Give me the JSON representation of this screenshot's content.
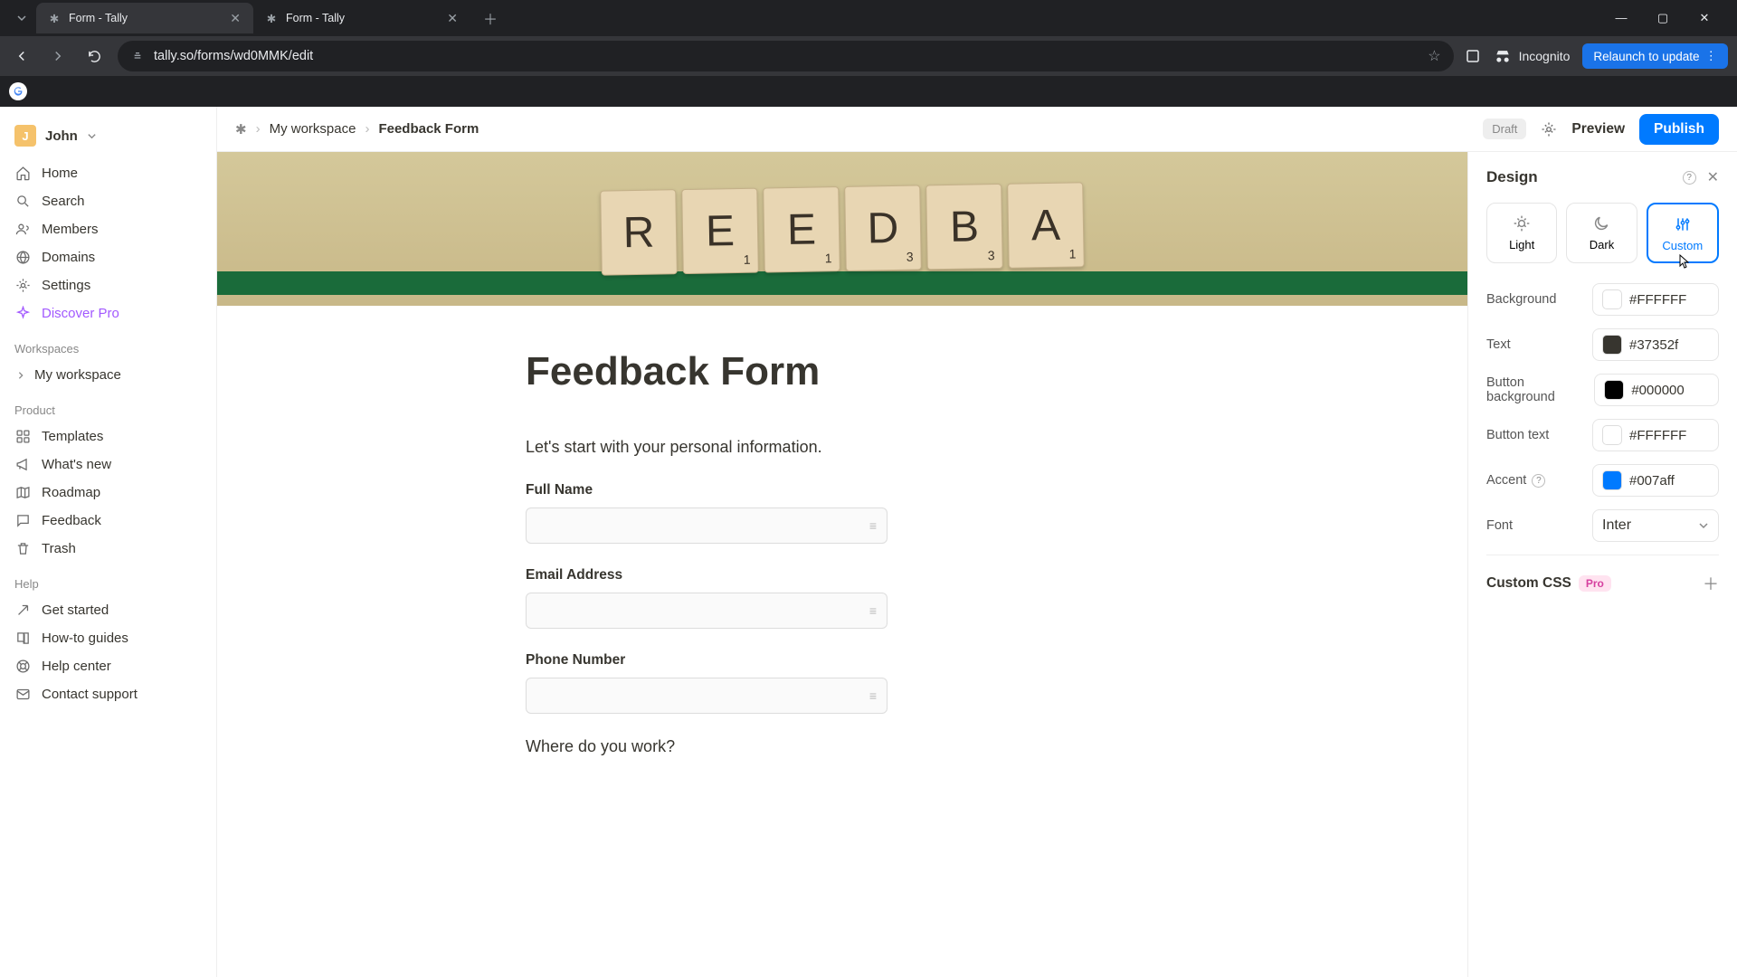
{
  "browser": {
    "tabs": [
      {
        "title": "Form - Tally",
        "active": true
      },
      {
        "title": "Form - Tally",
        "active": false
      }
    ],
    "url": "tally.so/forms/wd0MMK/edit",
    "incognito_label": "Incognito",
    "relaunch_label": "Relaunch to update",
    "bookmark_initial": "G"
  },
  "user": {
    "initial": "J",
    "name": "John"
  },
  "sidebar": {
    "nav": [
      {
        "key": "home",
        "label": "Home",
        "icon": "home"
      },
      {
        "key": "search",
        "label": "Search",
        "icon": "search"
      },
      {
        "key": "members",
        "label": "Members",
        "icon": "members"
      },
      {
        "key": "domains",
        "label": "Domains",
        "icon": "globe"
      },
      {
        "key": "settings",
        "label": "Settings",
        "icon": "gear"
      },
      {
        "key": "discover",
        "label": "Discover Pro",
        "icon": "sparkle",
        "pro": true
      }
    ],
    "workspaces_header": "Workspaces",
    "workspace_name": "My workspace",
    "product_header": "Product",
    "product": [
      {
        "key": "templates",
        "label": "Templates",
        "icon": "templates"
      },
      {
        "key": "whatsnew",
        "label": "What's new",
        "icon": "megaphone"
      },
      {
        "key": "roadmap",
        "label": "Roadmap",
        "icon": "map"
      },
      {
        "key": "feedback",
        "label": "Feedback",
        "icon": "chat"
      },
      {
        "key": "trash",
        "label": "Trash",
        "icon": "trash"
      }
    ],
    "help_header": "Help",
    "help": [
      {
        "key": "getstarted",
        "label": "Get started",
        "icon": "compass"
      },
      {
        "key": "howto",
        "label": "How-to guides",
        "icon": "book"
      },
      {
        "key": "helpcenter",
        "label": "Help center",
        "icon": "life"
      },
      {
        "key": "contact",
        "label": "Contact support",
        "icon": "mail"
      }
    ]
  },
  "breadcrumb": {
    "workspace": "My workspace",
    "form": "Feedback Form"
  },
  "topbar": {
    "draft": "Draft",
    "preview": "Preview",
    "publish": "Publish"
  },
  "cover_tiles": [
    {
      "letter": "R",
      "score": ""
    },
    {
      "letter": "E",
      "score": "1"
    },
    {
      "letter": "E",
      "score": "1"
    },
    {
      "letter": "D",
      "score": "3"
    },
    {
      "letter": "B",
      "score": "3"
    },
    {
      "letter": "A",
      "score": "1"
    }
  ],
  "form": {
    "title": "Feedback Form",
    "description": "Let's start with your personal information.",
    "fields": [
      {
        "label": "Full Name"
      },
      {
        "label": "Email Address"
      },
      {
        "label": "Phone Number"
      }
    ],
    "question2": "Where do you work?"
  },
  "design": {
    "title": "Design",
    "themes": {
      "light": "Light",
      "dark": "Dark",
      "custom": "Custom",
      "selected": "custom"
    },
    "rows": {
      "background": {
        "label": "Background",
        "value": "#FFFFFF",
        "swatch": "#FFFFFF"
      },
      "text": {
        "label": "Text",
        "value": "#37352f",
        "swatch": "#37352f"
      },
      "button_bg": {
        "label": "Button background",
        "value": "#000000",
        "swatch": "#000000"
      },
      "button_txt": {
        "label": "Button text",
        "value": "#FFFFFF",
        "swatch": "#FFFFFF"
      },
      "accent": {
        "label": "Accent",
        "value": "#007aff",
        "swatch": "#007aff"
      }
    },
    "font_label": "Font",
    "font_value": "Inter",
    "custom_css": "Custom CSS",
    "pro_badge": "Pro"
  }
}
